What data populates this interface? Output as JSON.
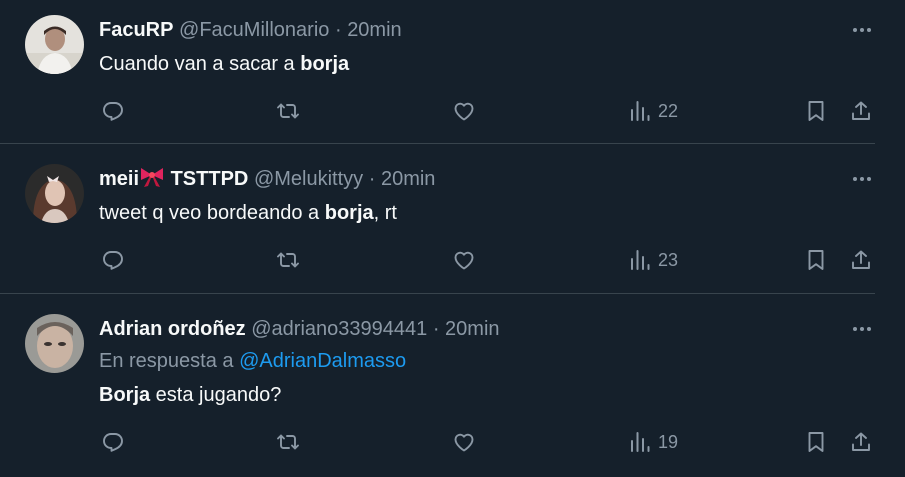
{
  "tweets": [
    {
      "name": "FacuRP",
      "handle": "@FacuMillonario",
      "dot": "·",
      "time": "20min",
      "text_before": "Cuando van a sacar a ",
      "text_bold": "borja",
      "text_after": "",
      "views": "22"
    },
    {
      "name": "meii",
      "name_suffix": " TSTTPD",
      "handle": "@Melukittyy",
      "dot": "·",
      "time": "20min",
      "text_before": "tweet q veo bordeando a ",
      "text_bold": "borja",
      "text_after": ", rt",
      "views": "23"
    },
    {
      "name": "Adrian ordoñez",
      "handle": "@adriano33994441",
      "dot": "·",
      "time": "20min",
      "reply_prefix": "En respuesta a ",
      "reply_to": "@AdrianDalmasso",
      "text_bold": "Borja",
      "text_after": " esta jugando?",
      "views": "19"
    }
  ],
  "colors": {
    "background": "#15202b",
    "text": "#f7f9f9",
    "muted": "#8b98a5",
    "link": "#1d9bf0",
    "border": "#38444d"
  },
  "icons": {
    "reply": "reply-icon",
    "retweet": "retweet-icon",
    "like": "heart-icon",
    "views": "views-icon",
    "bookmark": "bookmark-icon",
    "share": "share-icon",
    "more": "more-icon"
  }
}
